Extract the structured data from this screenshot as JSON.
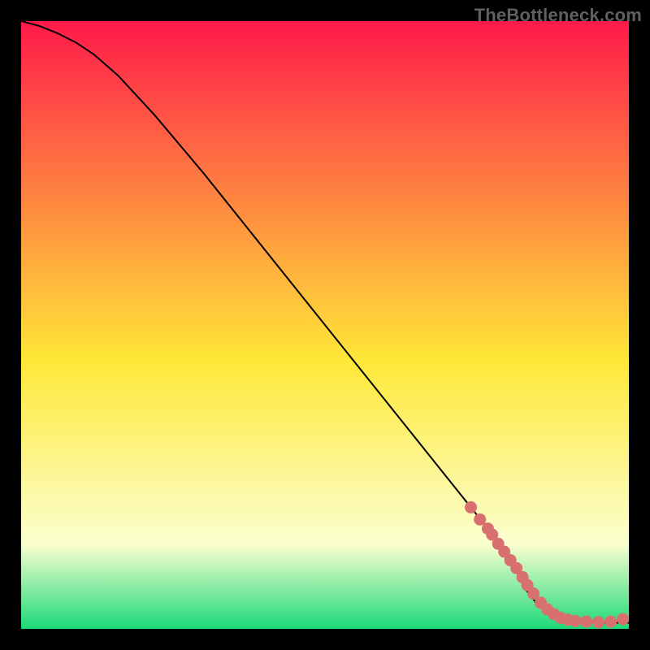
{
  "watermark": "TheBottleneck.com",
  "colors": {
    "gradient_top": "#ff1a4a",
    "gradient_yellow": "#ffe838",
    "gradient_pale": "#fbffd0",
    "gradient_green": "#1dd97a",
    "curve": "#000000",
    "marker": "#d8706f",
    "background": "#000000"
  },
  "chart_data": {
    "type": "line",
    "title": "",
    "xlabel": "",
    "ylabel": "",
    "xlim": [
      0,
      100
    ],
    "ylim": [
      0,
      100
    ],
    "grid": false,
    "legend": false,
    "series": [
      {
        "name": "curve",
        "kind": "line",
        "x": [
          0.0,
          3.0,
          6.0,
          9.0,
          12.0,
          16.0,
          22.0,
          30.0,
          40.0,
          50.0,
          60.0,
          70.0,
          76.0,
          80.0,
          82.0,
          83.0,
          85.0,
          88.0,
          92.0,
          96.0,
          100.0
        ],
        "y": [
          100.0,
          99.2,
          98.0,
          96.5,
          94.5,
          91.0,
          84.5,
          75.0,
          62.5,
          50.0,
          37.5,
          25.0,
          17.5,
          12.0,
          8.5,
          6.5,
          4.0,
          2.0,
          1.3,
          1.0,
          1.0
        ]
      },
      {
        "name": "markers",
        "kind": "scatter",
        "x": [
          74.0,
          75.5,
          76.8,
          77.5,
          78.5,
          79.5,
          80.5,
          81.5,
          82.5,
          83.3,
          84.3,
          85.5,
          86.6,
          87.7,
          88.8,
          90.0,
          91.2,
          93.0,
          95.0,
          97.0,
          99.0
        ],
        "y": [
          20.0,
          18.0,
          16.5,
          15.5,
          14.0,
          12.7,
          11.3,
          10.0,
          8.5,
          7.2,
          5.8,
          4.3,
          3.2,
          2.4,
          1.8,
          1.5,
          1.3,
          1.2,
          1.1,
          1.2,
          1.6
        ]
      }
    ]
  }
}
